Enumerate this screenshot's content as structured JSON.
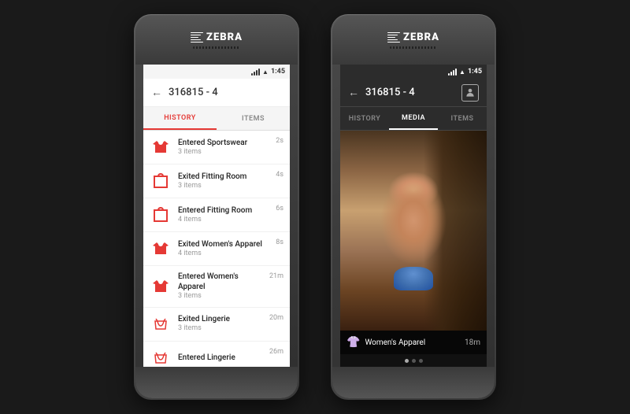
{
  "background": "#1a1a1a",
  "devices": {
    "left": {
      "brand": "ZEBRA",
      "status_bar": {
        "signal": true,
        "wifi": true,
        "battery": "1:45"
      },
      "header": {
        "title": "316815 - 4",
        "has_back": true
      },
      "tabs": [
        {
          "label": "HISTORY",
          "active": true
        },
        {
          "label": "ITEMS",
          "active": false
        }
      ],
      "list_items": [
        {
          "icon": "shirt",
          "title": "Entered Sportswear",
          "subtitle": "3 items",
          "time": "2s"
        },
        {
          "icon": "hanger",
          "title": "Exited Fitting Room",
          "subtitle": "3 items",
          "time": "4s"
        },
        {
          "icon": "hanger",
          "title": "Entered Fitting Room",
          "subtitle": "4 items",
          "time": "6s"
        },
        {
          "icon": "shirt-red",
          "title": "Exited Women's Apparel",
          "subtitle": "4 items",
          "time": "8s"
        },
        {
          "icon": "shirt-red",
          "title": "Entered Women's Apparel",
          "subtitle": "3 items",
          "time": "21m"
        },
        {
          "icon": "lingerie",
          "title": "Exited Lingerie",
          "subtitle": "3 items",
          "time": "20m"
        },
        {
          "icon": "lingerie",
          "title": "Entered Lingerie",
          "subtitle": "",
          "time": "26m"
        }
      ]
    },
    "right": {
      "brand": "ZEBRA",
      "status_bar": {
        "signal": true,
        "wifi": true,
        "battery": "1:45"
      },
      "header": {
        "title": "316815 - 4",
        "has_back": true,
        "has_person": true
      },
      "tabs": [
        {
          "label": "HISTORY",
          "active": false
        },
        {
          "label": "MEDIA",
          "active": true
        },
        {
          "label": "ITEMS",
          "active": false
        }
      ],
      "media": {
        "caption_icon": "👚",
        "caption_text": "Women's Apparel",
        "caption_time": "18m"
      },
      "dots": [
        true,
        false,
        false
      ]
    }
  }
}
